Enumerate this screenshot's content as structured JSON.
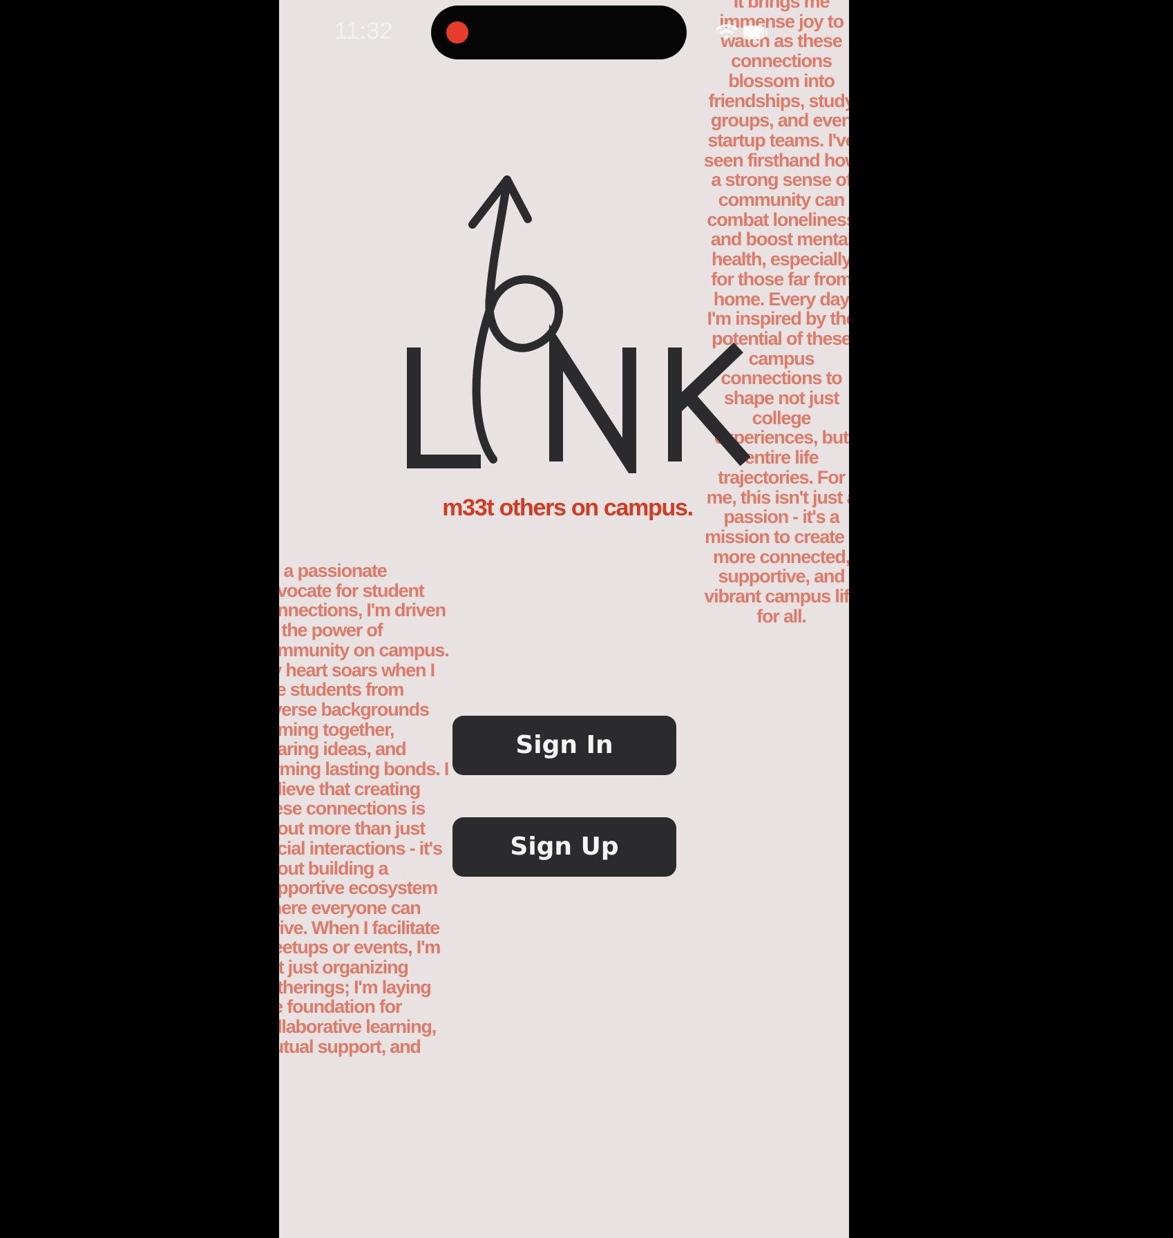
{
  "status_bar": {
    "time": "11:32",
    "icons": [
      "recording-indicator-icon",
      "wifi-icon",
      "battery-icon"
    ]
  },
  "logo": {
    "text": "LINK",
    "letters": [
      "L",
      "I",
      "N",
      "K"
    ]
  },
  "tagline": "m33t others on campus.",
  "buttons": {
    "sign_in": "Sign In",
    "sign_up": "Sign Up"
  },
  "background_text": {
    "right": "It brings me immense joy to watch as these connections blossom into friendships, study groups, and even startup teams. I've seen firsthand how a strong sense of community can combat loneliness and boost mental health, especially for those far from home. Every day I'm inspired by the potential of these campus connections to shape not just college experiences, but entire life trajectories. For me, this isn't just a passion - it's a mission to create a more connected, supportive, and vibrant campus life for all.",
    "left": "As a passionate advocate for student connections, I'm driven by the power of community on campus. My heart soars when I see students from diverse backgrounds coming together, sharing ideas, and forming lasting bonds. I believe that creating these connections is about more than just social interactions - it's about building a supportive ecosystem where everyone can thrive. When I facilitate meetups or events, I'm not just organizing gatherings; I'm laying the foundation for collaborative learning, mutual support, and"
  },
  "colors": {
    "background": "#e8e3e2",
    "accent_text": "#e07a68",
    "tagline": "#d23a22",
    "button": "#2b2a2c",
    "logo": "#2b2a2c"
  }
}
